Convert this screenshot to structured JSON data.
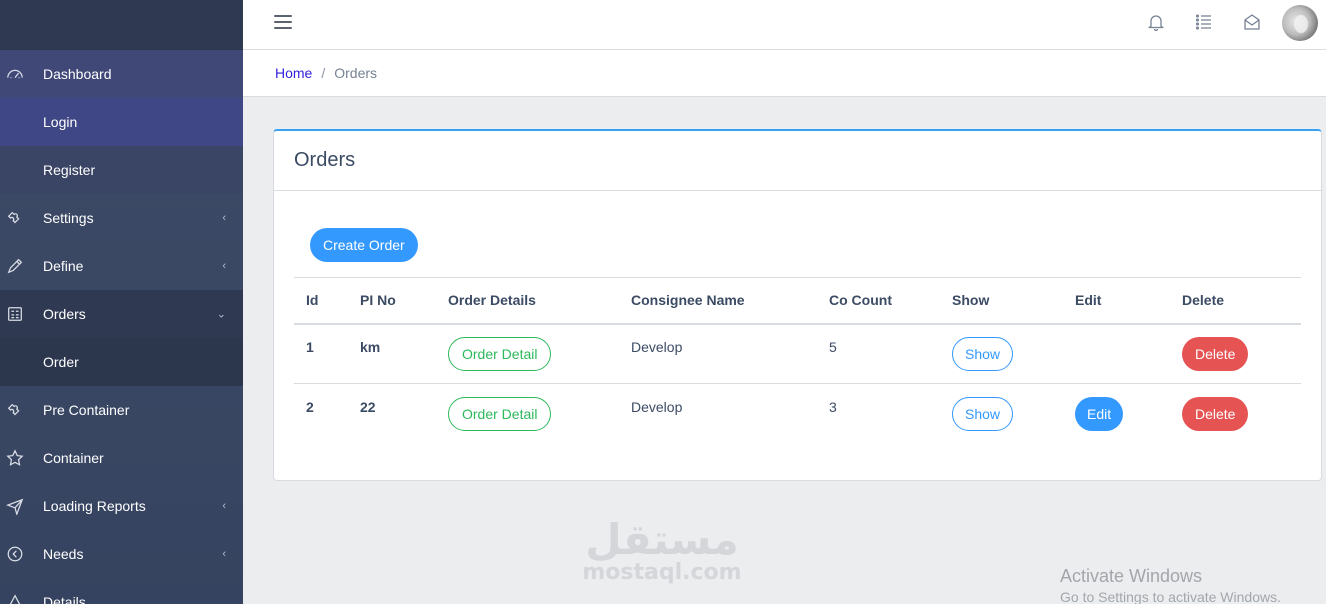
{
  "sidebar": {
    "items": [
      {
        "label": "Dashboard"
      },
      {
        "label": "Login"
      },
      {
        "label": "Register"
      },
      {
        "label": "Settings"
      },
      {
        "label": "Define"
      },
      {
        "label": "Orders"
      },
      {
        "label": "Order"
      },
      {
        "label": "Pre Container"
      },
      {
        "label": "Container"
      },
      {
        "label": "Loading Reports"
      },
      {
        "label": "Needs"
      },
      {
        "label": "Details"
      }
    ]
  },
  "breadcrumb": {
    "home": "Home",
    "separator": "/",
    "current": "Orders"
  },
  "card": {
    "title": "Orders",
    "create_label": "Create Order",
    "columns": [
      "Id",
      "PI No",
      "Order Details",
      "Consignee Name",
      "Co Count",
      "Show",
      "Edit",
      "Delete"
    ],
    "rows": [
      {
        "id": "1",
        "pi_no": "km",
        "details_label": "Order Detail",
        "consignee": "Develop",
        "co_count": "5",
        "show_label": "Show",
        "edit_label": "",
        "delete_label": "Delete"
      },
      {
        "id": "2",
        "pi_no": "22",
        "details_label": "Order Detail",
        "consignee": "Develop",
        "co_count": "3",
        "show_label": "Show",
        "edit_label": "Edit",
        "delete_label": "Delete"
      }
    ]
  },
  "watermark": {
    "arabic": "مستقل",
    "latin": "mostaql.com"
  },
  "os_notice": {
    "line1": "Activate Windows",
    "line2": "Go to Settings to activate Windows."
  },
  "colors": {
    "primary": "#3399ff",
    "success": "#2eb85c",
    "danger": "#e55353",
    "link": "#321fdb"
  }
}
